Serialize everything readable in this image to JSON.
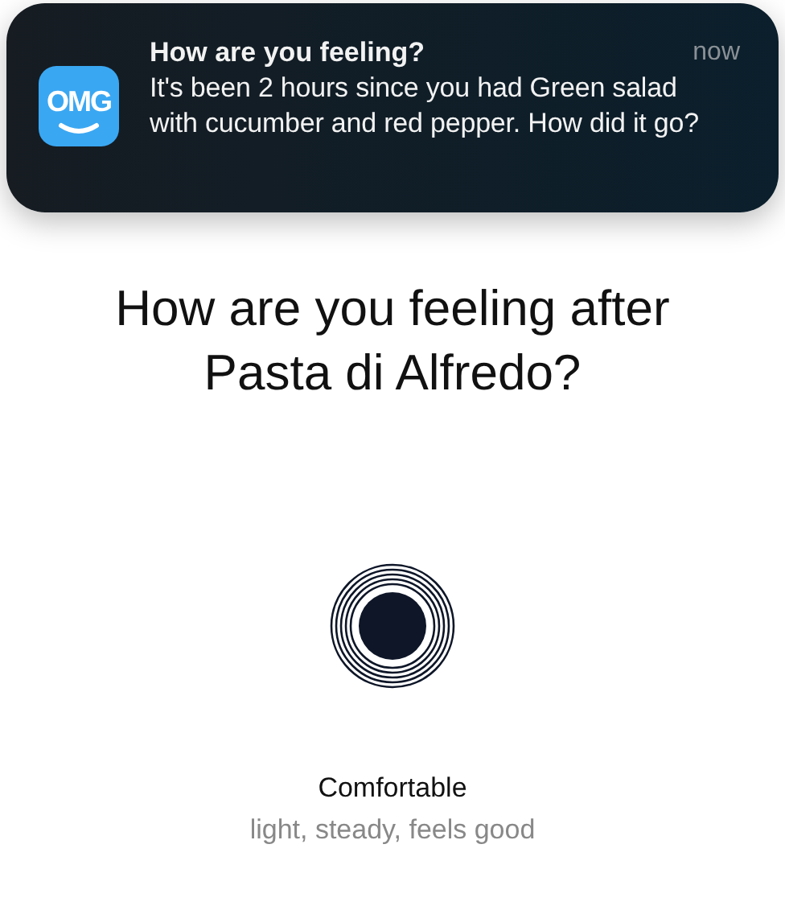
{
  "notification": {
    "app_logo": "OMG",
    "title": "How are you feeling?",
    "time": "now",
    "body": "It's been 2 hours since you had Green salad with cucumber and red pepper. How did it go?"
  },
  "question": "How are you feeling after Pasta di Alfredo?",
  "mood": {
    "label": "Comfortable",
    "description": "light, steady, feels good"
  }
}
